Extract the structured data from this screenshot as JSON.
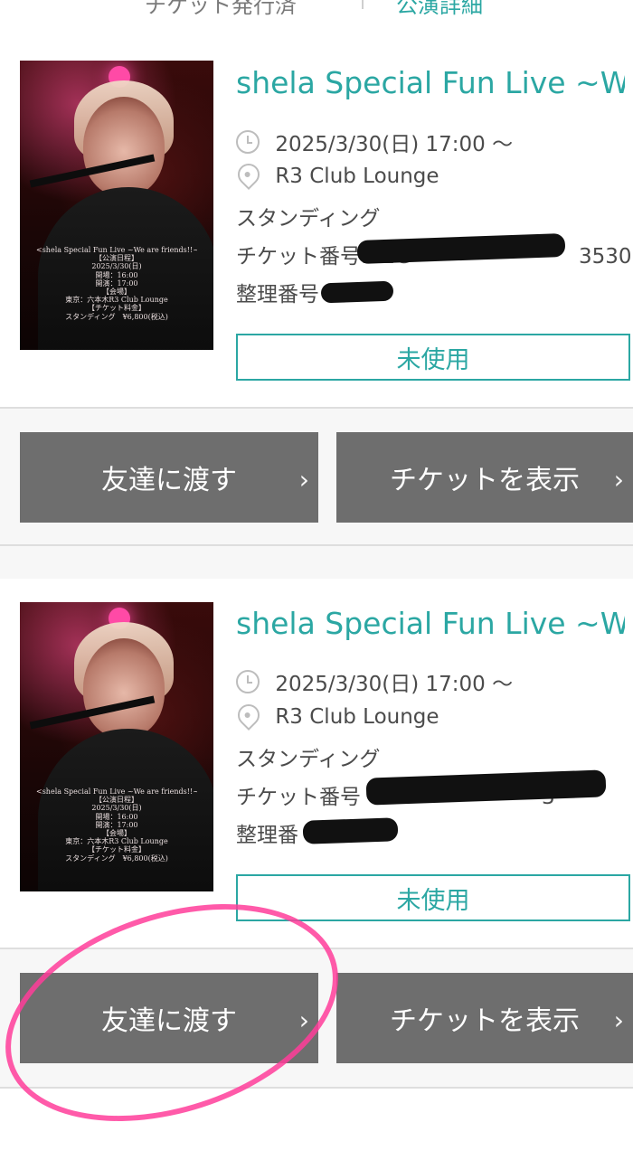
{
  "header": {
    "left_text": "チケット発行済",
    "right_text": "公演詳細"
  },
  "tickets": [
    {
      "title": "shela Special Fun Live ~W…",
      "datetime": "2025/3/30(日) 17:00 ～",
      "venue": "R3 Club Lounge",
      "seat_type": "スタンディング",
      "ticket_number_label": "チケット番号:V2G",
      "ticket_number_visible_suffix": "3530",
      "admission_label": "整理番号",
      "status": "未使用",
      "actions": {
        "transfer": "友達に渡す",
        "show": "チケットを表示"
      },
      "poster": {
        "line1": "<shela Special Fun Live ~We are friends!!~>",
        "line2": "【公演日程】",
        "line3": "2025/3/30(日)",
        "line4": "開場：16:00",
        "line5": "開演：17:00",
        "line6": "【会場】",
        "line7": "東京：六本木R3 Club Lounge",
        "line8": "【チケット料金】",
        "line9": "スタンディング　¥6,800(税込)"
      }
    },
    {
      "title": "shela Special Fun Live ~W…",
      "datetime": "2025/3/30(日) 17:00 ～",
      "venue": "R3 Club Lounge",
      "seat_type": "スタンディング",
      "ticket_number_label": "チケット番号",
      "ticket_number_visible_suffix": "3",
      "admission_label": "整理番",
      "status": "未使用",
      "actions": {
        "transfer": "友達に渡す",
        "show": "チケットを表示"
      },
      "poster": {
        "line1": "<shela Special Fun Live ~We are friends!!~>",
        "line2": "【公演日程】",
        "line3": "2025/3/30(日)",
        "line4": "開場：16:00",
        "line5": "開演：17:00",
        "line6": "【会場】",
        "line7": "東京：六本木R3 Club Lounge",
        "line8": "【チケット料金】",
        "line9": "スタンディング　¥6,800(税込)"
      }
    }
  ],
  "icons": {
    "chevron": "chevron-right-icon",
    "clock": "clock-icon",
    "location": "location-pin-icon"
  },
  "colors": {
    "accent": "#2ba7a3",
    "button_bg": "#6e6e6e",
    "highlight_circle": "#ff3d9a"
  }
}
